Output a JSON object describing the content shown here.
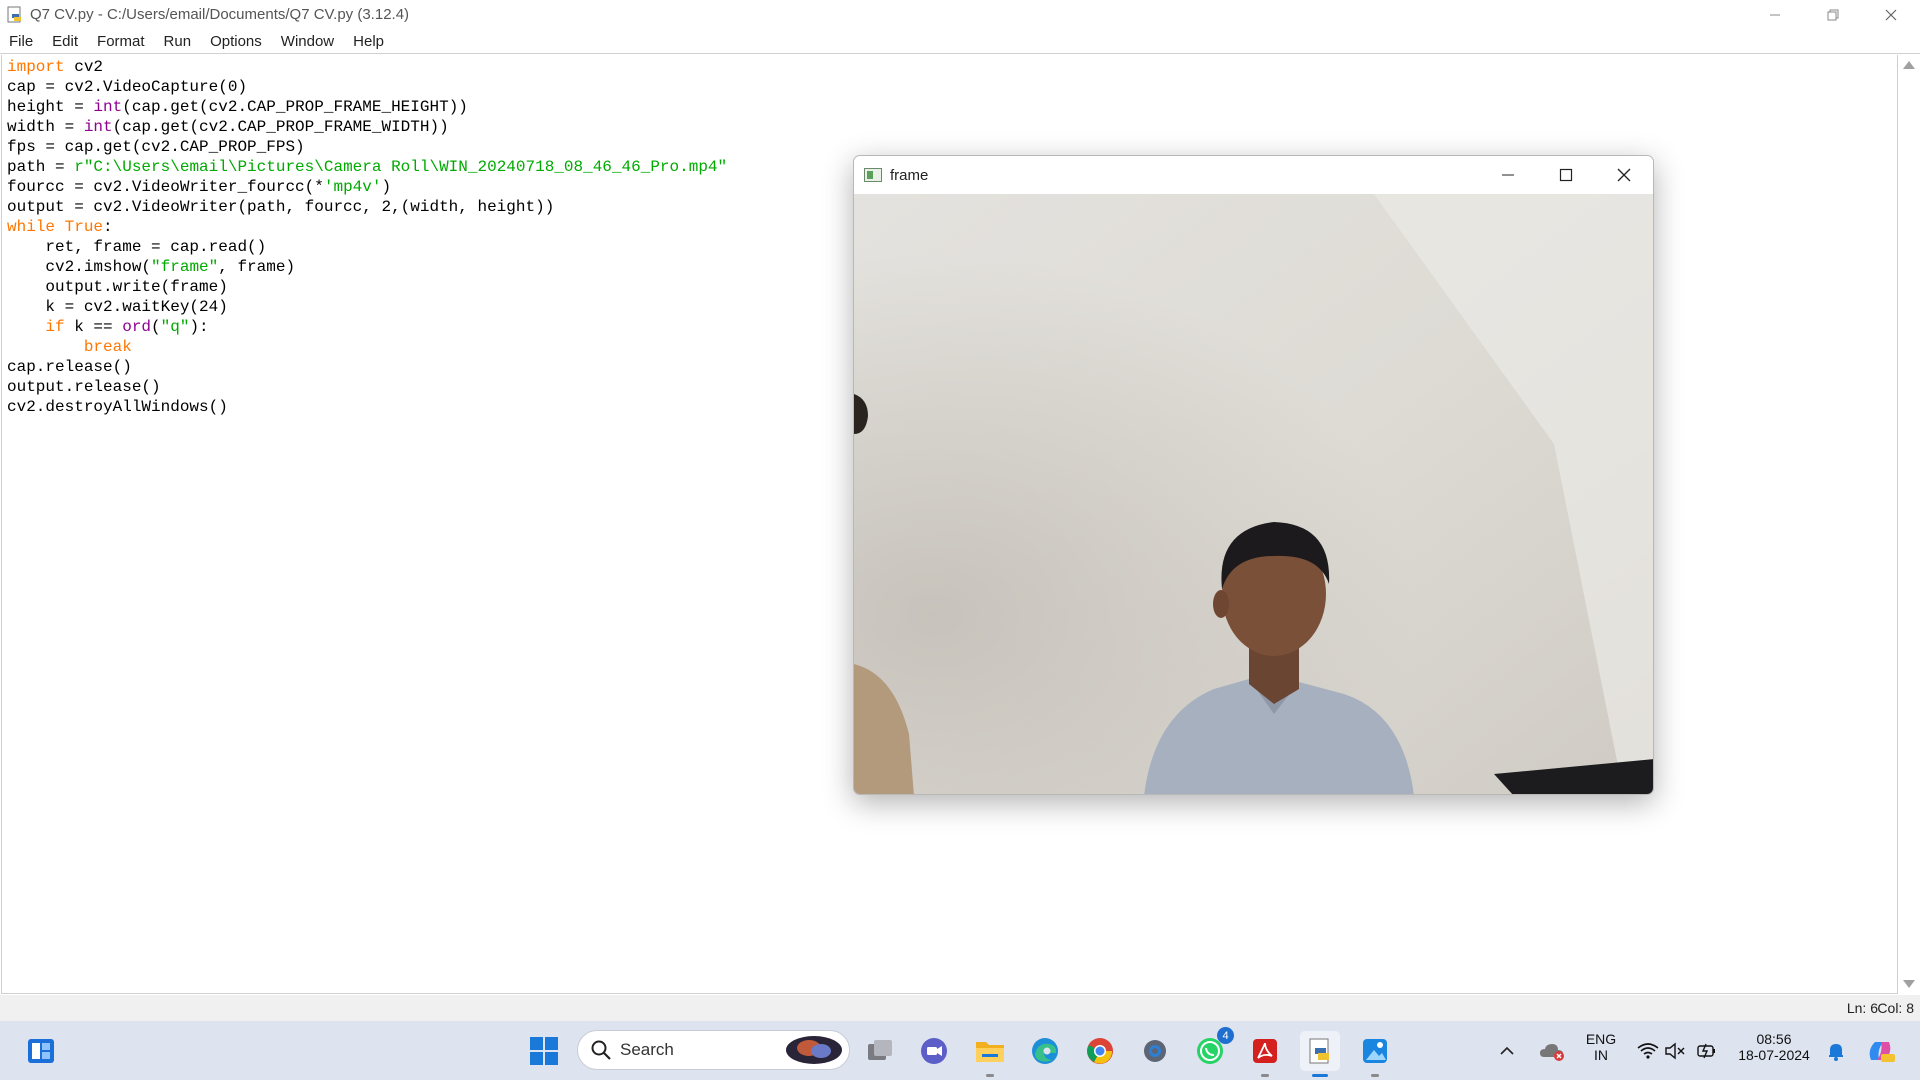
{
  "window": {
    "title": "Q7 CV.py - C:/Users/email/Documents/Q7 CV.py (3.12.4)"
  },
  "menu": [
    "File",
    "Edit",
    "Format",
    "Run",
    "Options",
    "Window",
    "Help"
  ],
  "code_lines": [
    [
      {
        "t": "import",
        "c": "kw"
      },
      {
        "t": " cv2"
      }
    ],
    [
      {
        "t": "cap = cv2.VideoCapture(0)"
      }
    ],
    [
      {
        "t": "height = "
      },
      {
        "t": "int",
        "c": "bi"
      },
      {
        "t": "(cap.get(cv2.CAP_PROP_FRAME_HEIGHT))"
      }
    ],
    [
      {
        "t": "width = "
      },
      {
        "t": "int",
        "c": "bi"
      },
      {
        "t": "(cap.get(cv2.CAP_PROP_FRAME_WIDTH))"
      }
    ],
    [
      {
        "t": "fps = cap.get(cv2.CAP_PROP_FPS)"
      }
    ],
    [
      {
        "t": "path = "
      },
      {
        "t": "r\"C:\\Users\\email\\Pictures\\Camera Roll\\WIN_20240718_08_46_46_Pro.mp4\"",
        "c": "st"
      }
    ],
    [
      {
        "t": "fourcc = cv2.VideoWriter_fourcc(*"
      },
      {
        "t": "'mp4v'",
        "c": "st"
      },
      {
        "t": ")"
      }
    ],
    [
      {
        "t": "output = cv2.VideoWriter(path, fourcc, 2,(width, height))"
      }
    ],
    [
      {
        "t": "while",
        "c": "kw"
      },
      {
        "t": " "
      },
      {
        "t": "True",
        "c": "kw"
      },
      {
        "t": ":"
      }
    ],
    [
      {
        "t": "    ret, frame = cap.read()"
      }
    ],
    [
      {
        "t": "    cv2.imshow("
      },
      {
        "t": "\"frame\"",
        "c": "st"
      },
      {
        "t": ", frame)"
      }
    ],
    [
      {
        "t": "    output.write(frame)"
      }
    ],
    [
      {
        "t": "    k = cv2.waitKey(24)"
      }
    ],
    [
      {
        "t": "    "
      },
      {
        "t": "if",
        "c": "kw"
      },
      {
        "t": " k == "
      },
      {
        "t": "ord",
        "c": "bi"
      },
      {
        "t": "("
      },
      {
        "t": "\"q\"",
        "c": "st"
      },
      {
        "t": "):"
      }
    ],
    [
      {
        "t": "        "
      },
      {
        "t": "break",
        "c": "kw"
      }
    ],
    [
      {
        "t": "cap.release()"
      }
    ],
    [
      {
        "t": "output.release()"
      }
    ],
    [
      {
        "t": "cv2.destroyAllWindows()"
      }
    ]
  ],
  "status": {
    "ln": "Ln: 6",
    "col": "Col: 8"
  },
  "frame_window": {
    "title": "frame"
  },
  "taskbar": {
    "search_label": "Search",
    "whatsapp_badge": "4",
    "lang_top": "ENG",
    "lang_bottom": "IN",
    "time": "08:56",
    "date": "18-07-2024"
  },
  "icons": {
    "start": "windows-start-icon",
    "search": "search-icon",
    "task_view": "task-view-icon",
    "meet": "video-chat-icon",
    "explorer": "file-explorer-icon",
    "edge": "edge-icon",
    "chrome": "chrome-icon",
    "settings": "gear-icon",
    "whatsapp": "whatsapp-icon",
    "acrobat": "acrobat-icon",
    "idle": "python-idle-icon",
    "photos": "photos-icon"
  }
}
